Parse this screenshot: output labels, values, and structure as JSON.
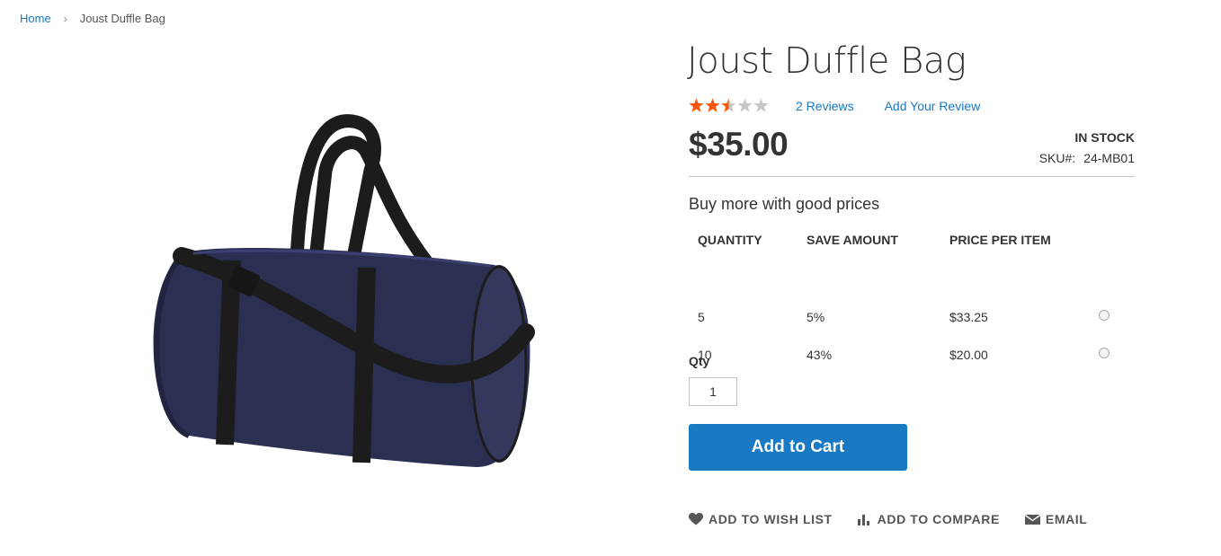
{
  "breadcrumb": {
    "home": "Home",
    "current": "Joust Duffle Bag"
  },
  "product": {
    "name": "Joust Duffle Bag",
    "rating_fraction": 0.5,
    "rating_stars_total": 5,
    "reviews_link": "2  Reviews",
    "add_review_link": "Add Your Review",
    "price": "$35.00",
    "stock_status": "In stock",
    "sku_label": "SKU#:",
    "sku_value": "24-MB01",
    "image_icon": "duffle-bag-image"
  },
  "tier_prices": {
    "title": "Buy more with good prices",
    "headers": [
      "QUANTITY",
      "SAVE AMOUNT",
      "PRICE PER ITEM"
    ],
    "rows": [
      {
        "quantity": "5",
        "save": "5%",
        "price": "$33.25"
      },
      {
        "quantity": "10",
        "save": "43%",
        "price": "$20.00"
      }
    ]
  },
  "qty": {
    "label": "Qty",
    "value": "1"
  },
  "add_to_cart_label": "Add to Cart",
  "actions": {
    "wishlist": "Add to Wish List",
    "compare": "Add to Compare",
    "email": "Email"
  },
  "colors": {
    "accent": "#1979c3",
    "star_filled": "#ff5501",
    "star_empty": "#c7c7c7",
    "bag_body": "#2b2f52",
    "bag_strap": "#1c1c1c"
  }
}
